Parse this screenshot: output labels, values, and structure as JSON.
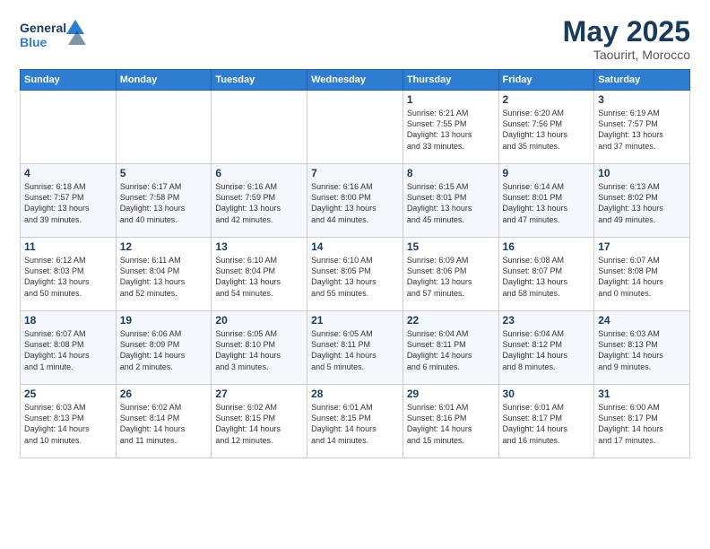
{
  "logo": {
    "line1": "General",
    "line2": "Blue"
  },
  "title": "May 2025",
  "subtitle": "Taourirt, Morocco",
  "days_of_week": [
    "Sunday",
    "Monday",
    "Tuesday",
    "Wednesday",
    "Thursday",
    "Friday",
    "Saturday"
  ],
  "weeks": [
    [
      {
        "day": "",
        "info": ""
      },
      {
        "day": "",
        "info": ""
      },
      {
        "day": "",
        "info": ""
      },
      {
        "day": "",
        "info": ""
      },
      {
        "day": "1",
        "info": "Sunrise: 6:21 AM\nSunset: 7:55 PM\nDaylight: 13 hours\nand 33 minutes."
      },
      {
        "day": "2",
        "info": "Sunrise: 6:20 AM\nSunset: 7:56 PM\nDaylight: 13 hours\nand 35 minutes."
      },
      {
        "day": "3",
        "info": "Sunrise: 6:19 AM\nSunset: 7:57 PM\nDaylight: 13 hours\nand 37 minutes."
      }
    ],
    [
      {
        "day": "4",
        "info": "Sunrise: 6:18 AM\nSunset: 7:57 PM\nDaylight: 13 hours\nand 39 minutes."
      },
      {
        "day": "5",
        "info": "Sunrise: 6:17 AM\nSunset: 7:58 PM\nDaylight: 13 hours\nand 40 minutes."
      },
      {
        "day": "6",
        "info": "Sunrise: 6:16 AM\nSunset: 7:59 PM\nDaylight: 13 hours\nand 42 minutes."
      },
      {
        "day": "7",
        "info": "Sunrise: 6:16 AM\nSunset: 8:00 PM\nDaylight: 13 hours\nand 44 minutes."
      },
      {
        "day": "8",
        "info": "Sunrise: 6:15 AM\nSunset: 8:01 PM\nDaylight: 13 hours\nand 45 minutes."
      },
      {
        "day": "9",
        "info": "Sunrise: 6:14 AM\nSunset: 8:01 PM\nDaylight: 13 hours\nand 47 minutes."
      },
      {
        "day": "10",
        "info": "Sunrise: 6:13 AM\nSunset: 8:02 PM\nDaylight: 13 hours\nand 49 minutes."
      }
    ],
    [
      {
        "day": "11",
        "info": "Sunrise: 6:12 AM\nSunset: 8:03 PM\nDaylight: 13 hours\nand 50 minutes."
      },
      {
        "day": "12",
        "info": "Sunrise: 6:11 AM\nSunset: 8:04 PM\nDaylight: 13 hours\nand 52 minutes."
      },
      {
        "day": "13",
        "info": "Sunrise: 6:10 AM\nSunset: 8:04 PM\nDaylight: 13 hours\nand 54 minutes."
      },
      {
        "day": "14",
        "info": "Sunrise: 6:10 AM\nSunset: 8:05 PM\nDaylight: 13 hours\nand 55 minutes."
      },
      {
        "day": "15",
        "info": "Sunrise: 6:09 AM\nSunset: 8:06 PM\nDaylight: 13 hours\nand 57 minutes."
      },
      {
        "day": "16",
        "info": "Sunrise: 6:08 AM\nSunset: 8:07 PM\nDaylight: 13 hours\nand 58 minutes."
      },
      {
        "day": "17",
        "info": "Sunrise: 6:07 AM\nSunset: 8:08 PM\nDaylight: 14 hours\nand 0 minutes."
      }
    ],
    [
      {
        "day": "18",
        "info": "Sunrise: 6:07 AM\nSunset: 8:08 PM\nDaylight: 14 hours\nand 1 minute."
      },
      {
        "day": "19",
        "info": "Sunrise: 6:06 AM\nSunset: 8:09 PM\nDaylight: 14 hours\nand 2 minutes."
      },
      {
        "day": "20",
        "info": "Sunrise: 6:05 AM\nSunset: 8:10 PM\nDaylight: 14 hours\nand 3 minutes."
      },
      {
        "day": "21",
        "info": "Sunrise: 6:05 AM\nSunset: 8:11 PM\nDaylight: 14 hours\nand 5 minutes."
      },
      {
        "day": "22",
        "info": "Sunrise: 6:04 AM\nSunset: 8:11 PM\nDaylight: 14 hours\nand 6 minutes."
      },
      {
        "day": "23",
        "info": "Sunrise: 6:04 AM\nSunset: 8:12 PM\nDaylight: 14 hours\nand 8 minutes."
      },
      {
        "day": "24",
        "info": "Sunrise: 6:03 AM\nSunset: 8:13 PM\nDaylight: 14 hours\nand 9 minutes."
      }
    ],
    [
      {
        "day": "25",
        "info": "Sunrise: 6:03 AM\nSunset: 8:13 PM\nDaylight: 14 hours\nand 10 minutes."
      },
      {
        "day": "26",
        "info": "Sunrise: 6:02 AM\nSunset: 8:14 PM\nDaylight: 14 hours\nand 11 minutes."
      },
      {
        "day": "27",
        "info": "Sunrise: 6:02 AM\nSunset: 8:15 PM\nDaylight: 14 hours\nand 12 minutes."
      },
      {
        "day": "28",
        "info": "Sunrise: 6:01 AM\nSunset: 8:15 PM\nDaylight: 14 hours\nand 14 minutes."
      },
      {
        "day": "29",
        "info": "Sunrise: 6:01 AM\nSunset: 8:16 PM\nDaylight: 14 hours\nand 15 minutes."
      },
      {
        "day": "30",
        "info": "Sunrise: 6:01 AM\nSunset: 8:17 PM\nDaylight: 14 hours\nand 16 minutes."
      },
      {
        "day": "31",
        "info": "Sunrise: 6:00 AM\nSunset: 8:17 PM\nDaylight: 14 hours\nand 17 minutes."
      }
    ]
  ]
}
